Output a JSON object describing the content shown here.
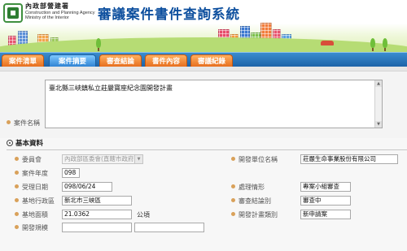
{
  "header": {
    "org_name_zh": "內政部營建署",
    "org_name_en": "Construction and Planning Agency Ministry of the Interior",
    "site_title": "審議案件書件查詢系統"
  },
  "tabs": [
    {
      "label": "案件清單",
      "active": false
    },
    {
      "label": "案件摘要",
      "active": true
    },
    {
      "label": "審查結論",
      "active": false
    },
    {
      "label": "書件內容",
      "active": false
    },
    {
      "label": "審議紀錄",
      "active": false
    }
  ],
  "case": {
    "label": "案件名稱",
    "value": "臺北縣三峽鎮私立莊嚴寶座紀念園開發計畫"
  },
  "basic_info": {
    "title": "基本資料",
    "committee": {
      "label": "委員會",
      "value": "內政部區委會(直轄市政府)"
    },
    "year": {
      "label": "案件年度",
      "value": "098"
    },
    "accept_date": {
      "label": "受理日期",
      "value": "098/06/24"
    },
    "district": {
      "label": "基地行政區",
      "value": "新北市三峽區"
    },
    "area": {
      "label": "基地面積",
      "value": "21.0362",
      "unit": "公頃"
    },
    "scale": {
      "label": "開發規模",
      "value1": "",
      "value2": ""
    },
    "developer": {
      "label": "開發單位名稱",
      "value": "莊嚴生命事業股份有限公司"
    },
    "status": {
      "label": "處理情形",
      "value": "專案小組審查"
    },
    "conclusion": {
      "label": "審查結論別",
      "value": "審查中"
    },
    "plan_type": {
      "label": "開發計畫類別",
      "value": "新申請案"
    }
  },
  "colors": {
    "title_blue": "#0d4f9e",
    "tab_orange": "#e56a1a",
    "tab_active_blue": "#2b7fd0",
    "tabbar_blue": "#1d63a8",
    "bullet": "#d9a15a"
  }
}
